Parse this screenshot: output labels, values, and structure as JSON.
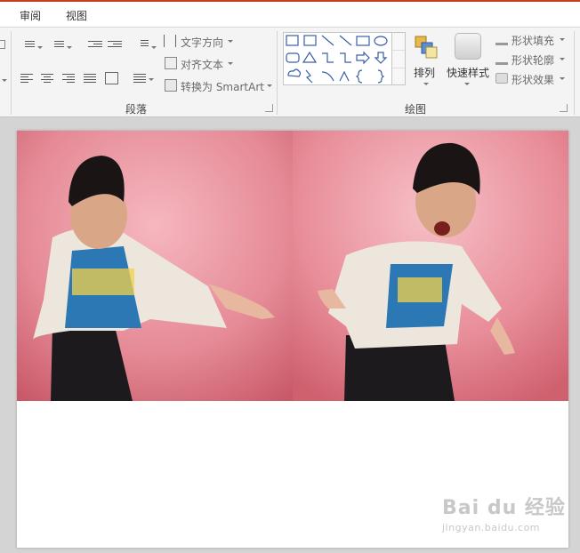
{
  "tabs": [
    {
      "label": "审阅"
    },
    {
      "label": "视图"
    }
  ],
  "paragraph_group": {
    "label": "段落",
    "text_direction": "文字方向",
    "align_text": "对齐文本",
    "convert_smartart": "转换为 SmartArt"
  },
  "drawing_group": {
    "label": "绘图",
    "arrange": "排列",
    "quick_styles": "快速样式",
    "shape_fill": "形状填充",
    "shape_outline": "形状轮廓",
    "shape_effects": "形状效果"
  },
  "watermark": {
    "logo": "Bai du 经验",
    "url": "jingyan.baidu.com"
  },
  "colors": {
    "accent": "#c43e1c",
    "photo_pink": "#e2848f",
    "jacket": "#ece6dc",
    "shirt": "#2c78b4"
  }
}
